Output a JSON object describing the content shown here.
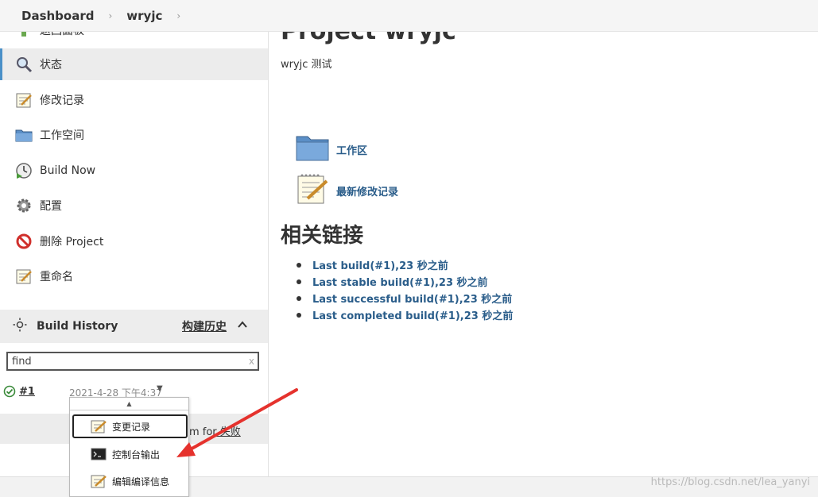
{
  "breadcrumb": {
    "items": [
      "Dashboard",
      "wryjc"
    ],
    "separator": "›"
  },
  "sidebar": {
    "items": [
      {
        "label": "返回面板",
        "icon": "up-arrow-icon",
        "active": false
      },
      {
        "label": "状态",
        "icon": "search-icon",
        "active": true
      },
      {
        "label": "修改记录",
        "icon": "notepad-icon",
        "active": false
      },
      {
        "label": "工作空间",
        "icon": "folder-icon",
        "active": false
      },
      {
        "label": "Build Now",
        "icon": "clock-build-icon",
        "active": false
      },
      {
        "label": "配置",
        "icon": "gear-icon",
        "active": false
      },
      {
        "label": "删除 Project",
        "icon": "no-entry-icon",
        "active": false
      },
      {
        "label": "重命名",
        "icon": "notepad-icon",
        "active": false
      }
    ]
  },
  "build_history": {
    "title": "Build History",
    "trend_label": "构建历史",
    "search_placeholder": "find",
    "search_value": "find",
    "clear_glyph": "x",
    "builds": [
      {
        "number": "#1",
        "date": "2021-4-28 下午4:37",
        "status": "success"
      }
    ],
    "feed_text_prefix": "om fo",
    "feed_text_link": "r 失败"
  },
  "dropdown": {
    "items": [
      {
        "label": "变更记录",
        "icon": "notepad-icon",
        "selected": true
      },
      {
        "label": "控制台输出",
        "icon": "terminal-icon",
        "selected": false
      },
      {
        "label": "编辑编译信息",
        "icon": "notepad-icon",
        "selected": false
      }
    ]
  },
  "main": {
    "title": "Project wryjc",
    "description": "wryjc 测试",
    "links": [
      {
        "label": "工作区",
        "icon": "folder-icon"
      },
      {
        "label": "最新修改记录",
        "icon": "notepad-icon"
      }
    ],
    "related_title": "相关链接",
    "related_links": [
      "Last build(#1),23 秒之前",
      "Last stable build(#1),23 秒之前",
      "Last successful build(#1),23 秒之前",
      "Last completed build(#1),23 秒之前"
    ]
  },
  "watermark": "https://blog.csdn.net/lea_yanyi",
  "colors": {
    "link": "#2a5d8a",
    "active_border": "#4a90c8",
    "annotation_arrow": "#e5322d",
    "success": "#3a8a3a"
  }
}
